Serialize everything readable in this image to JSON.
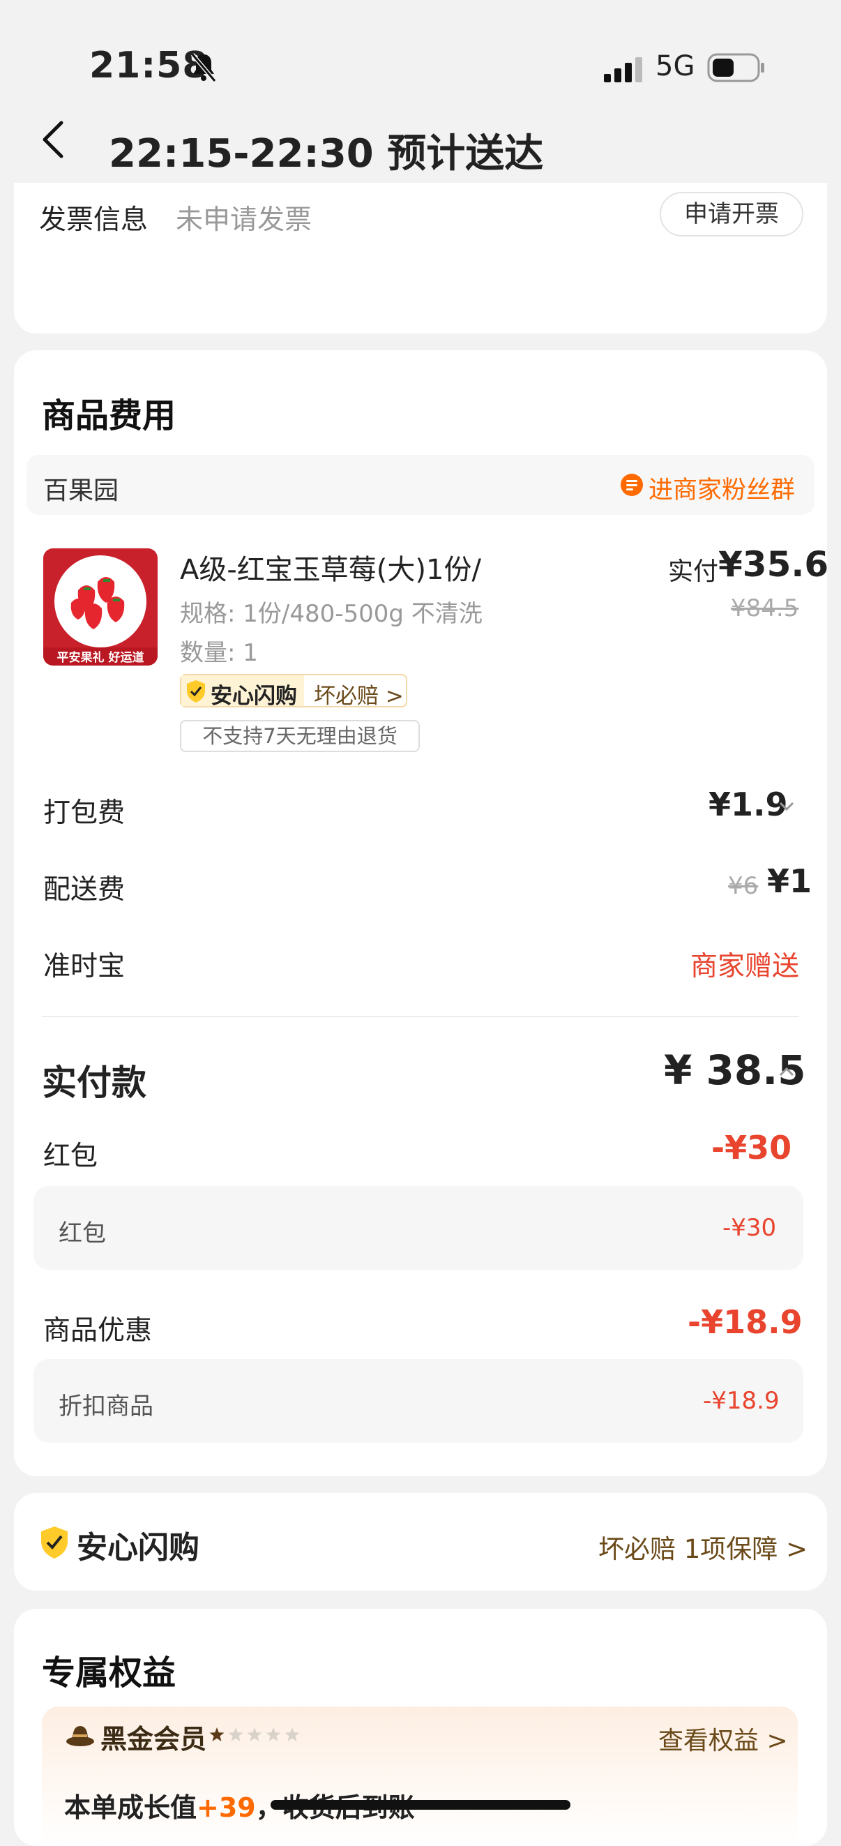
{
  "status_bar": {
    "time": "21:58",
    "network": "5G"
  },
  "header": {
    "title": "22:15-22:30 预计送达"
  },
  "invoice": {
    "label": "发票信息",
    "value": "未申请发票",
    "button": "申请开票"
  },
  "goods": {
    "section_title": "商品费用",
    "shop_name": "百果园",
    "fans_group": "进商家粉丝群",
    "product": {
      "name": "A级-红宝玉草莓(大)1份/",
      "spec": "规格: 1份/480-500g 不清洗",
      "qty": "数量: 1",
      "tag_main": "安心闪购",
      "tag_sub": "坏必赔 >",
      "no_return": "不支持7天无理由退货",
      "paid_label": "实付",
      "paid_price": "¥35.6",
      "original_price": "¥84.5",
      "thumb_caption": "平安果礼 好运道"
    },
    "packing": {
      "label": "打包费",
      "value": "¥1.9"
    },
    "delivery": {
      "label": "配送费",
      "original": "¥6",
      "value": "¥1"
    },
    "ontime": {
      "label": "准时宝",
      "value": "商家赠送"
    },
    "total": {
      "label": "实付款",
      "value": "¥ 38.5"
    },
    "redpacket": {
      "label": "红包",
      "value": "-¥30",
      "detail_label": "红包",
      "detail_value": "-¥30"
    },
    "discount": {
      "label": "商品优惠",
      "value": "-¥18.9",
      "detail_label": "折扣商品",
      "detail_value": "-¥18.9"
    }
  },
  "assurance": {
    "title": "安心闪购",
    "right": "坏必赔 1项保障 >"
  },
  "benefits": {
    "section_title": "专属权益",
    "member": "黑金会员",
    "member_stars": 1,
    "view_link": "查看权益 >",
    "growth_prefix": "本单成长值",
    "growth_value": "+39",
    "growth_suffix": "，收货后到账"
  },
  "colors": {
    "accent_orange": "#ff6a00",
    "discount_red": "#e8442e",
    "brown": "#6b4a1a"
  }
}
